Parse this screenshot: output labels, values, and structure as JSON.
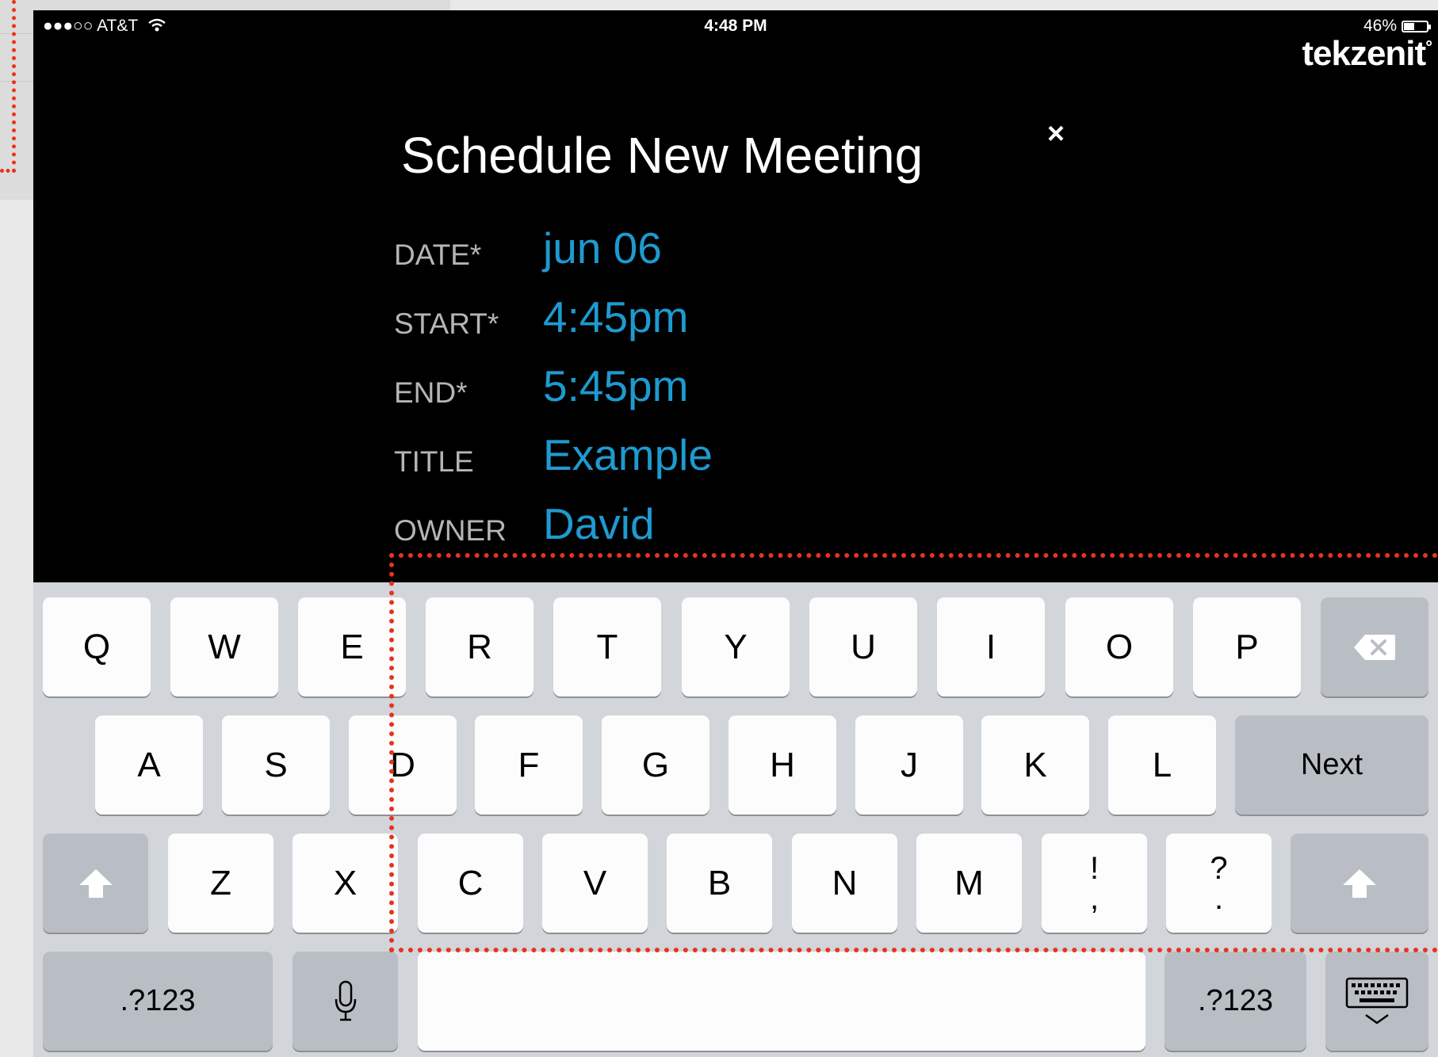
{
  "status_bar": {
    "carrier": "●●●○○ AT&T",
    "time": "4:48 PM",
    "battery": "46%"
  },
  "brand": {
    "logo": "tekzenit",
    "logo_mark": "°"
  },
  "dialog": {
    "title": "Schedule New Meeting",
    "close_icon": "×",
    "fields": [
      {
        "label": "DATE*",
        "value": "jun 06"
      },
      {
        "label": "START*",
        "value": "4:45pm"
      },
      {
        "label": "END*",
        "value": "5:45pm"
      },
      {
        "label": "TITLE",
        "value": "Example"
      },
      {
        "label": "OWNER",
        "value": "David"
      }
    ]
  },
  "keyboard": {
    "row1": [
      "Q",
      "W",
      "E",
      "R",
      "T",
      "Y",
      "U",
      "I",
      "O",
      "P"
    ],
    "row2": [
      "A",
      "S",
      "D",
      "F",
      "G",
      "H",
      "J",
      "K",
      "L"
    ],
    "row3": [
      "Z",
      "X",
      "C",
      "V",
      "B",
      "N",
      "M"
    ],
    "punct1": {
      "top": "!",
      "bottom": ","
    },
    "punct2": {
      "top": "?",
      "bottom": "."
    },
    "next_label": "Next",
    "numbers_label": ".?123",
    "numbers_label_right": ".?123",
    "icons": {
      "backspace": "backspace-icon",
      "shift": "shift-icon",
      "mic": "microphone-icon",
      "dismiss": "keyboard-dismiss-icon"
    }
  },
  "colors": {
    "accent": "#1e9ad0",
    "label": "#b5b5b5",
    "annotation": "#e8331d"
  }
}
